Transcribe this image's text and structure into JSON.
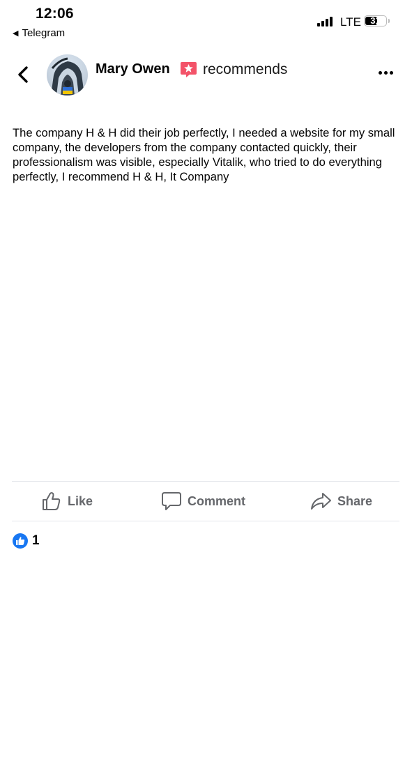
{
  "status_bar": {
    "time": "12:06",
    "back_app": "Telegram",
    "network": "LTE",
    "battery": "31"
  },
  "header": {
    "author": "Mary Owen",
    "action": "recommends",
    "badge_icon": "recommend-star-icon",
    "badge_color": "#f35369"
  },
  "post": {
    "text": "The company H & H did their job perfectly, I needed a website for my small company, the developers from the company contacted quickly, their professionalism was visible, especially Vitalik, who tried to do everything perfectly, I recommend H & H, It Company"
  },
  "actions": {
    "like": "Like",
    "comment": "Comment",
    "share": "Share"
  },
  "reactions": {
    "count": "1",
    "icon": "like-reaction-icon",
    "color": "#1877f2"
  }
}
